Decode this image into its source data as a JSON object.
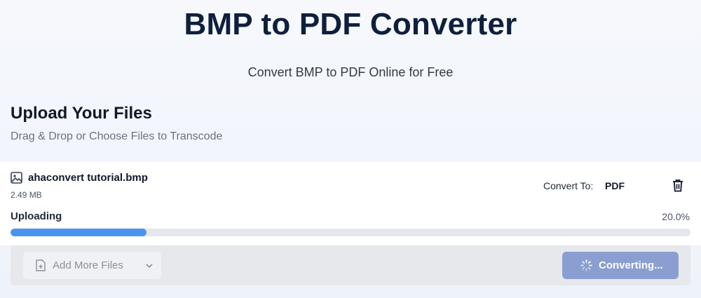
{
  "header": {
    "title": "BMP to PDF Converter",
    "subtitle": "Convert BMP to PDF Online for Free"
  },
  "upload": {
    "heading": "Upload Your Files",
    "subheading": "Drag & Drop or Choose Files to Transcode"
  },
  "file": {
    "icon": "image-file-icon",
    "name": "ahaconvert tutorial.bmp",
    "size": "2.49 MB",
    "convert_to_label": "Convert To:",
    "target_format": "PDF",
    "delete_icon": "trash-icon",
    "status": "Uploading",
    "progress_text": "20.0%",
    "progress_fraction": 0.2
  },
  "actions": {
    "add_more_label": "Add More Files",
    "add_more_icon": "file-plus-icon",
    "dropdown_icon": "chevron-down-icon",
    "convert_label": "Converting...",
    "convert_icon": "spinner-icon"
  },
  "colors": {
    "progress": "#4a94ef",
    "convert_button": "#8b9ed1",
    "title": "#0f1f3d"
  }
}
